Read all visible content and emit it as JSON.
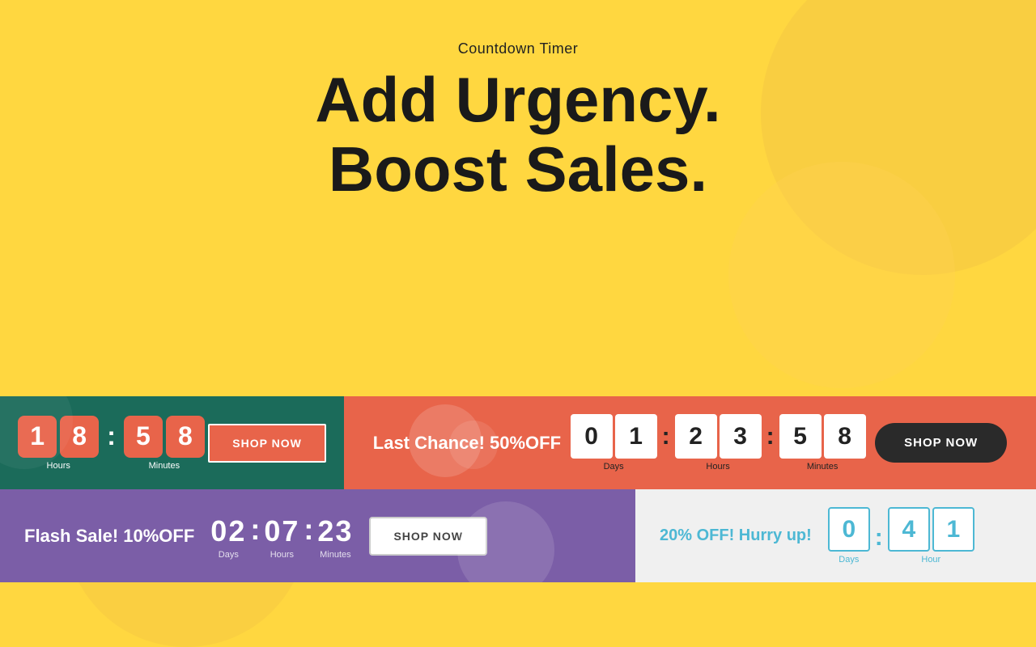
{
  "page": {
    "background_color": "#FFD740",
    "subtitle": "Countdown Timer",
    "headline_line1": "Add Urgency.",
    "headline_line2": "Boost Sales."
  },
  "card_green": {
    "hours_digits": [
      "1",
      "8"
    ],
    "minutes_digits": [
      "5",
      "8"
    ],
    "hours_label": "Hours",
    "minutes_label": "Minutes",
    "button_label": "SHOP NOW"
  },
  "card_orange": {
    "promo_text": "Last Chance! 50%OFF",
    "days_digits": [
      "0",
      "1"
    ],
    "hours_digits": [
      "2",
      "3"
    ],
    "minutes_digits": [
      "5",
      "8"
    ],
    "days_label": "Days",
    "hours_label": "Hours",
    "minutes_label": "Minutes",
    "button_label": "SHOP NOW"
  },
  "card_purple": {
    "promo_text": "Flash Sale! 10%OFF",
    "days": "02",
    "hours": "07",
    "minutes": "23",
    "days_label": "Days",
    "hours_label": "Hours",
    "minutes_label": "Minutes",
    "button_label": "SHOP NOW"
  },
  "card_white": {
    "promo_text": "20% OFF! Hurry up!",
    "days_digit": "0",
    "hours_digit1": "4",
    "hours_digit2": "1",
    "days_label": "Days",
    "hours_label": "Hour"
  }
}
